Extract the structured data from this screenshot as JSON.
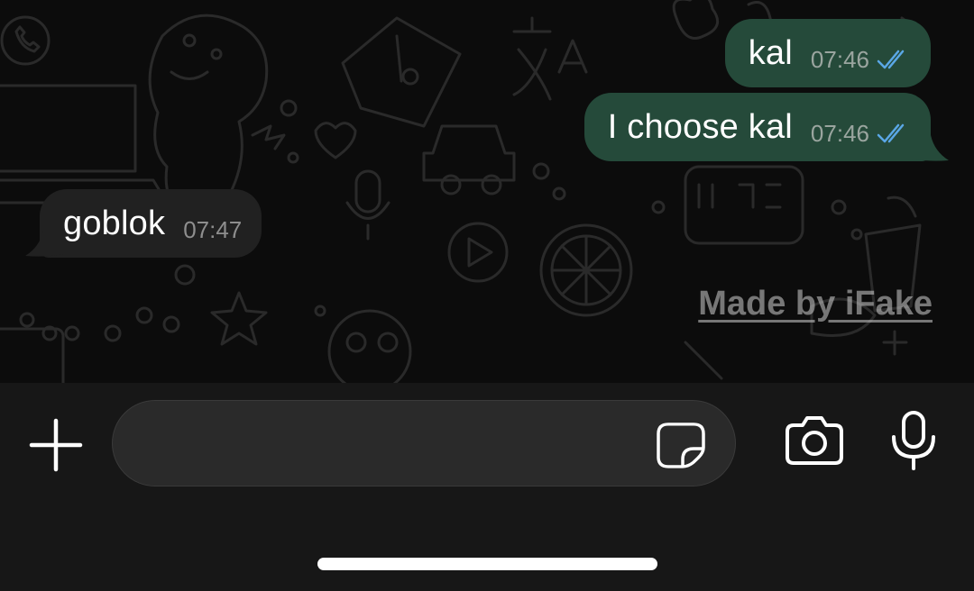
{
  "messages": [
    {
      "direction": "outgoing",
      "text": "kal",
      "time": "07:46",
      "status": "read"
    },
    {
      "direction": "outgoing",
      "text": "I choose kal",
      "time": "07:46",
      "status": "read"
    },
    {
      "direction": "incoming",
      "text": "goblok",
      "time": "07:47"
    }
  ],
  "watermark": "Made by iFake",
  "composer": {
    "placeholder": "",
    "value": ""
  },
  "icons": {
    "attach": "plus-icon",
    "sticker": "sticker-icon",
    "camera": "camera-icon",
    "mic": "microphone-icon",
    "read_receipt": "double-check-icon"
  },
  "colors": {
    "outgoing_bubble": "#254a3a",
    "incoming_bubble": "#212121",
    "read_receipt": "#5aa7e6",
    "background": "#0c0c0c"
  }
}
